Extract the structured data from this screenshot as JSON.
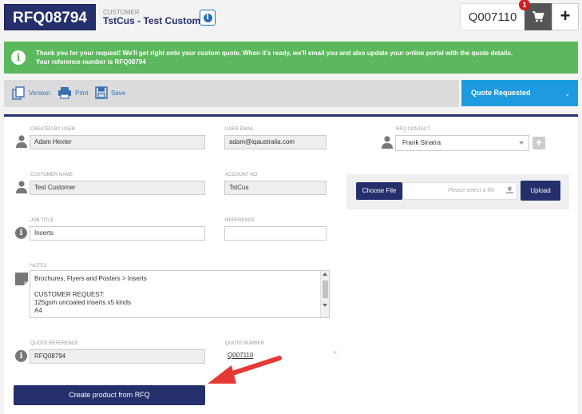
{
  "header": {
    "rfq_id": "RFQ08794",
    "customer_label": "CUSTOMER",
    "customer_name": "TstCus - Test Customer",
    "quote_number": "Q007110",
    "cart_count": "1",
    "plus_label": "+"
  },
  "alert": {
    "line1": "Thank you for your request! We'll get right onto your custom quote. When it's ready, we'll email you and also update your online portal with the quote details.",
    "line2": "Your reference number is RFQ08794"
  },
  "toolbar": {
    "version_label": "Version",
    "print_label": "Print",
    "save_label": "Save",
    "status_label": "Quote Requested",
    "status_caret": "⌄"
  },
  "form": {
    "created_by_label": "CREATED BY USER",
    "created_by_value": "Adam Hexter",
    "user_email_label": "USER EMAIL",
    "user_email_value": "adam@iqaustralia.com",
    "rfq_contact_label": "RFQ CONTACT",
    "rfq_contact_value": "Frank Sinatra",
    "customer_name_label": "CUSTOMER NAME",
    "customer_name_value": "Test Customer",
    "account_no_label": "ACCOUNT NO",
    "account_no_value": "TstCus",
    "job_title_label": "JOB TITLE",
    "job_title_value": "Inserts",
    "reference_label": "REFERENCE",
    "reference_value": "",
    "notes_label": "NOTES",
    "notes_lines": [
      "Brochures, Flyers and Posters > Inserts",
      "",
      "CUSTOMER REQUEST:",
      "125gsm uncoated inserts x5 kinds",
      "A4"
    ],
    "quote_reference_label": "QUOTE REFERENCE",
    "quote_reference_value": "RFQ08794",
    "quote_number_label": "QUOTE NUMBER",
    "quote_number_value": "Q007110"
  },
  "upload": {
    "choose_label": "Choose File",
    "placeholder": "Please select a file",
    "upload_label": "Upload"
  },
  "actions": {
    "create_label": "Create product from RFQ",
    "close_symbol": "×"
  },
  "colors": {
    "navy": "#252f6b",
    "green": "#5cb85c",
    "blue": "#1e9be0",
    "badge_red": "#d41e1e"
  }
}
